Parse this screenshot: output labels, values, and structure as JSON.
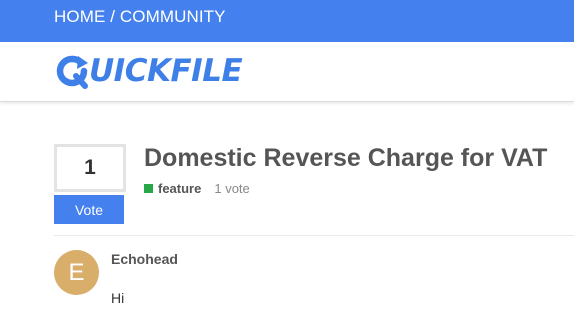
{
  "breadcrumb": {
    "text": "HOME / COMMUNITY"
  },
  "logo": {
    "text": "UICKFILE",
    "mark_letter": "Q",
    "brand_color": "#3f80e8"
  },
  "topic": {
    "vote_count": "1",
    "vote_button_label": "Vote",
    "title": "Domestic Reverse Charge for VAT",
    "category": "feature",
    "category_color": "#27a745",
    "votes_label": "1 vote"
  },
  "post": {
    "avatar_letter": "E",
    "avatar_color": "#d8ae6a",
    "username": "Echohead",
    "body": "Hi"
  },
  "colors": {
    "accent": "#4480ee"
  }
}
